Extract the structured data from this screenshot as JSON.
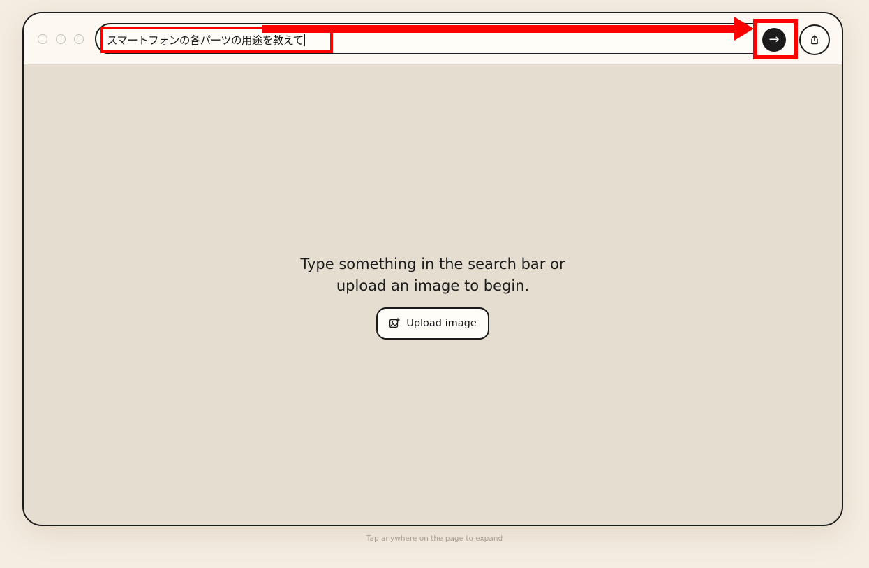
{
  "browser": {
    "search": {
      "value": "スマートフォンの各パーツの用途を教えて",
      "submit_icon": "→"
    },
    "icons": {
      "submit": "arrow-right-icon",
      "share": "share-icon",
      "upload": "image-add-icon"
    }
  },
  "main": {
    "prompt_line1": "Type something in the search bar or",
    "prompt_line2": "upload an image to begin.",
    "upload_label": "Upload image"
  },
  "footer": {
    "hint": "Tap anywhere on the page to expand"
  },
  "colors": {
    "page_bg": "#f4ede2",
    "content_bg": "#e4ddd0",
    "annotation": "#ff0000",
    "ink": "#1b1b1b"
  }
}
